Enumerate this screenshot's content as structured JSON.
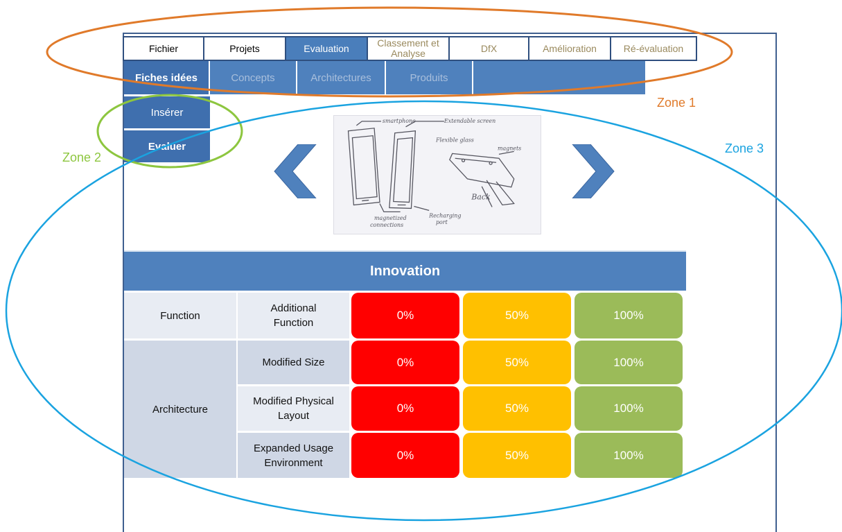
{
  "top_menu": [
    "Fichier",
    "Projets",
    "Evaluation",
    "Classement et Analyse",
    "DfX",
    "Amélioration",
    "Ré-évaluation"
  ],
  "sub_menu": [
    "Fiches idées",
    "Concepts",
    "Architectures",
    "Produits",
    ""
  ],
  "side_menu": {
    "insert": "Insérer",
    "evaluate": "Evaluer"
  },
  "zones": {
    "zone1": "Zone 1",
    "zone2": "Zone 2",
    "zone3": "Zone 3"
  },
  "colors": {
    "zone1": "#e07a2a",
    "zone2": "#8dc63f",
    "zone3": "#1aa3e0",
    "accent": "#4f81bd",
    "score_low": "#ff0000",
    "score_mid": "#ffc000",
    "score_high": "#9bbb59"
  },
  "table": {
    "title": "Innovation",
    "categories": {
      "function": "Function",
      "architecture": "Architecture"
    },
    "criteria": [
      "Additional Function",
      "Modified Size",
      "Modified Physical Layout",
      "Expanded Usage Environment"
    ],
    "scores": [
      "0%",
      "50%",
      "100%"
    ]
  },
  "icons": {
    "prev": "chevron-left-icon",
    "next": "chevron-right-icon"
  }
}
